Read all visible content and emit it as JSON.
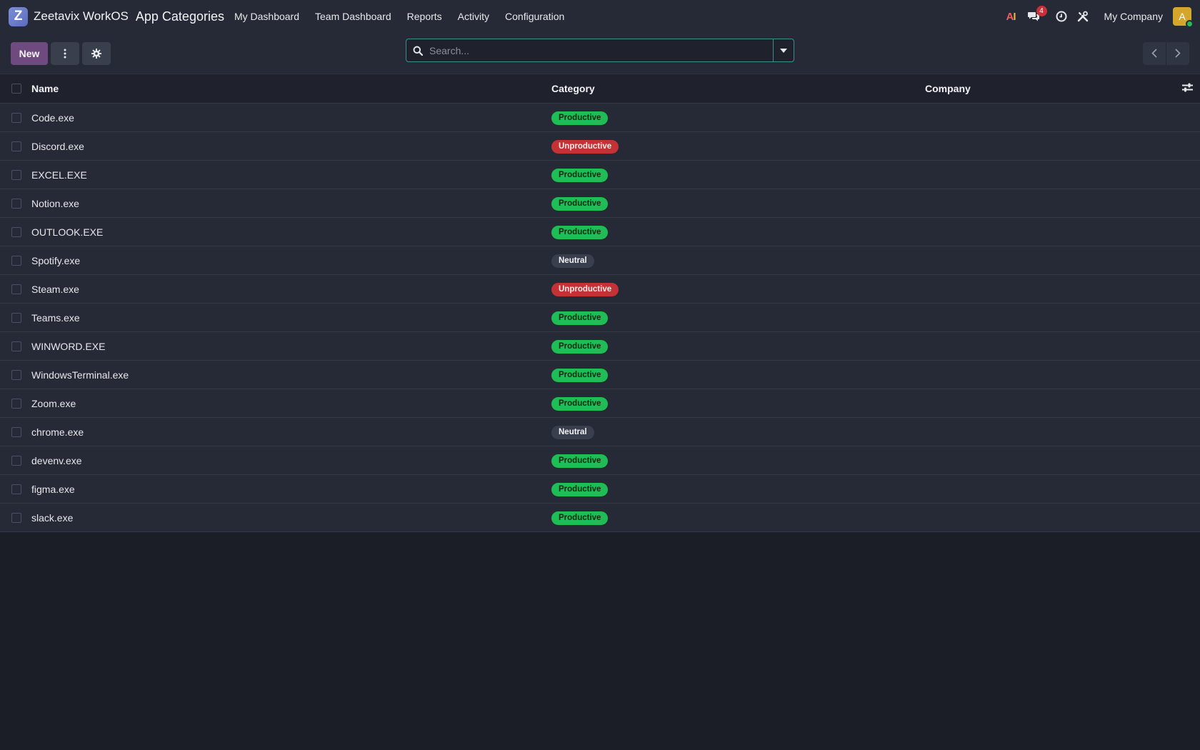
{
  "navbar": {
    "brand_letter": "Z",
    "brand_name": "Zeetavix WorkOS",
    "app_title": "App Categories",
    "menu": [
      {
        "label": "My Dashboard"
      },
      {
        "label": "Team Dashboard"
      },
      {
        "label": "Reports"
      },
      {
        "label": "Activity"
      },
      {
        "label": "Configuration"
      }
    ],
    "ai_label": "AI",
    "messages_badge": "4",
    "company": "My Company",
    "avatar_letter": "A"
  },
  "control": {
    "new_label": "New",
    "search_placeholder": "Search..."
  },
  "table": {
    "headers": {
      "name": "Name",
      "category": "Category",
      "company": "Company"
    },
    "rows": [
      {
        "name": "Code.exe",
        "category": "Productive",
        "company": ""
      },
      {
        "name": "Discord.exe",
        "category": "Unproductive",
        "company": ""
      },
      {
        "name": "EXCEL.EXE",
        "category": "Productive",
        "company": ""
      },
      {
        "name": "Notion.exe",
        "category": "Productive",
        "company": ""
      },
      {
        "name": "OUTLOOK.EXE",
        "category": "Productive",
        "company": ""
      },
      {
        "name": "Spotify.exe",
        "category": "Neutral",
        "company": ""
      },
      {
        "name": "Steam.exe",
        "category": "Unproductive",
        "company": ""
      },
      {
        "name": "Teams.exe",
        "category": "Productive",
        "company": ""
      },
      {
        "name": "WINWORD.EXE",
        "category": "Productive",
        "company": ""
      },
      {
        "name": "WindowsTerminal.exe",
        "category": "Productive",
        "company": ""
      },
      {
        "name": "Zoom.exe",
        "category": "Productive",
        "company": ""
      },
      {
        "name": "chrome.exe",
        "category": "Neutral",
        "company": ""
      },
      {
        "name": "devenv.exe",
        "category": "Productive",
        "company": ""
      },
      {
        "name": "figma.exe",
        "category": "Productive",
        "company": ""
      },
      {
        "name": "slack.exe",
        "category": "Productive",
        "company": ""
      }
    ]
  },
  "colors": {
    "productive": "#1fbd56",
    "unproductive": "#c43235",
    "neutral": "#3a3f4e",
    "accent": "#6e4a7e"
  }
}
